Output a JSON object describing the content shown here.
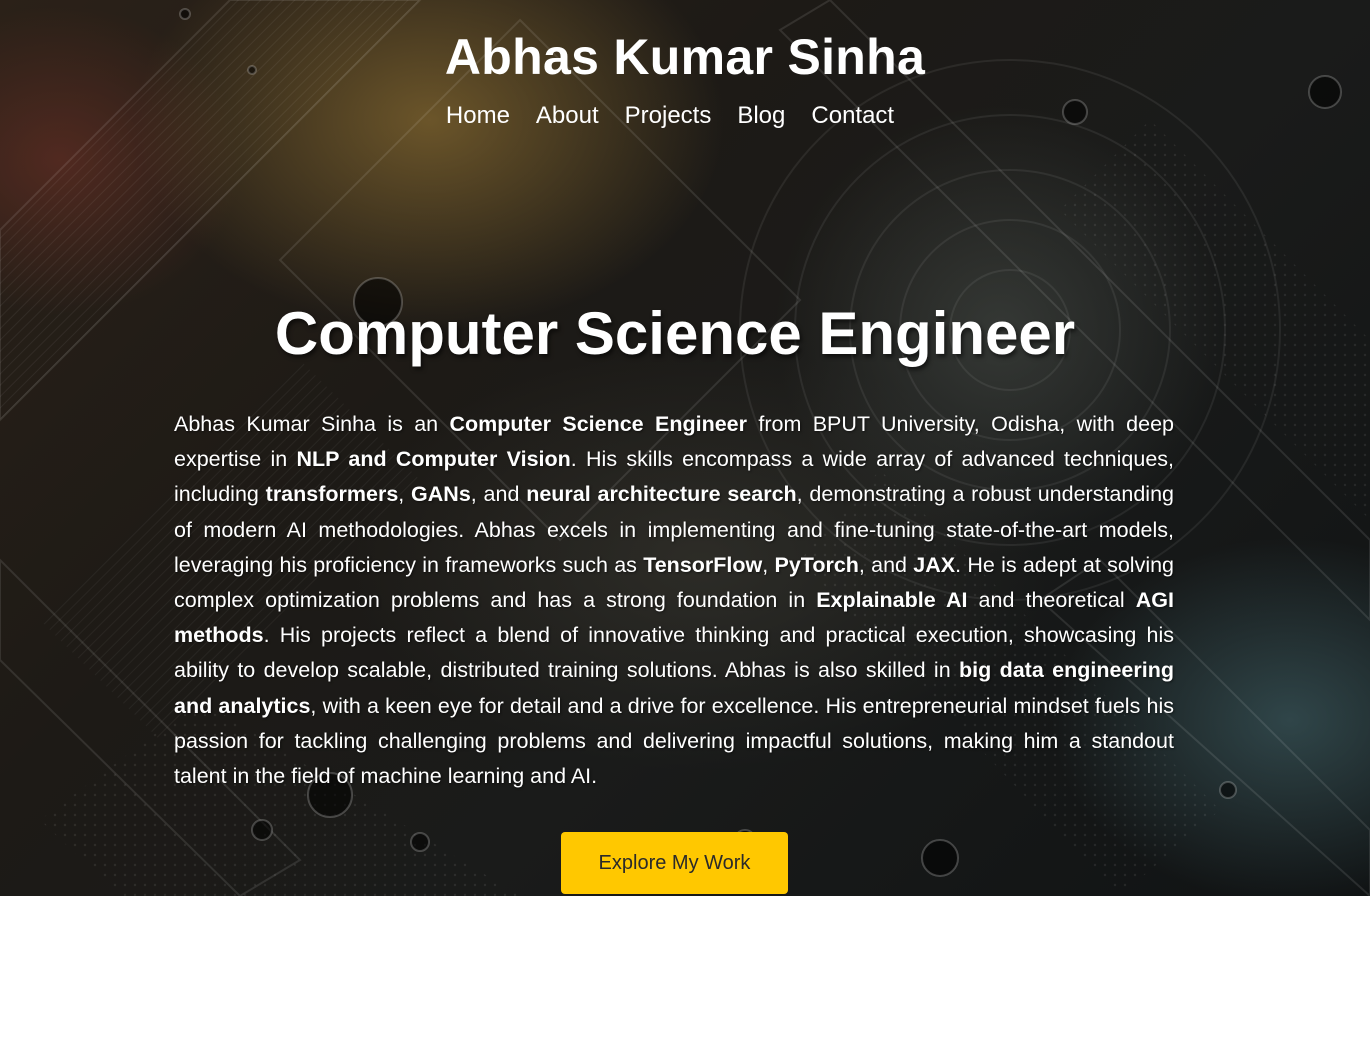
{
  "header": {
    "title": "Abhas Kumar Sinha",
    "nav": [
      {
        "label": "Home"
      },
      {
        "label": "About"
      },
      {
        "label": "Projects"
      },
      {
        "label": "Blog"
      },
      {
        "label": "Contact"
      }
    ]
  },
  "hero": {
    "title": "Computer Science Engineer",
    "bio_segments": [
      {
        "text": "Abhas Kumar Sinha is an ",
        "bold": false
      },
      {
        "text": "Computer Science Engineer",
        "bold": true
      },
      {
        "text": " from BPUT University, Odisha, with deep expertise in ",
        "bold": false
      },
      {
        "text": "NLP and Computer Vision",
        "bold": true
      },
      {
        "text": ". His skills encompass a wide array of advanced techniques, including ",
        "bold": false
      },
      {
        "text": "transformers",
        "bold": true
      },
      {
        "text": ", ",
        "bold": false
      },
      {
        "text": "GANs",
        "bold": true
      },
      {
        "text": ", and ",
        "bold": false
      },
      {
        "text": "neural architecture search",
        "bold": true
      },
      {
        "text": ", demonstrating a robust understanding of modern AI methodologies. Abhas excels in implementing and fine-tuning state-of-the-art models, leveraging his proficiency in frameworks such as ",
        "bold": false
      },
      {
        "text": "TensorFlow",
        "bold": true
      },
      {
        "text": ", ",
        "bold": false
      },
      {
        "text": "PyTorch",
        "bold": true
      },
      {
        "text": ", and ",
        "bold": false
      },
      {
        "text": "JAX",
        "bold": true
      },
      {
        "text": ". He is adept at solving complex optimization problems and has a strong foundation in ",
        "bold": false
      },
      {
        "text": "Explainable AI",
        "bold": true
      },
      {
        "text": " and theoretical ",
        "bold": false
      },
      {
        "text": "AGI methods",
        "bold": true
      },
      {
        "text": ". His projects reflect a blend of innovative thinking and practical execution, showcasing his ability to develop scalable, distributed training solutions. Abhas is also skilled in ",
        "bold": false
      },
      {
        "text": "big data engineering and analytics",
        "bold": true
      },
      {
        "text": ", with a keen eye for detail and a drive for excellence. His entrepreneurial mindset fuels his passion for tackling challenging problems and delivering impactful solutions, making him a standout talent in the field of machine learning and AI.",
        "bold": false
      }
    ],
    "cta_label": "Explore My Work"
  },
  "colors": {
    "accent": "#ffc800",
    "text": "#ffffff",
    "button_text": "#2a2a2a"
  }
}
